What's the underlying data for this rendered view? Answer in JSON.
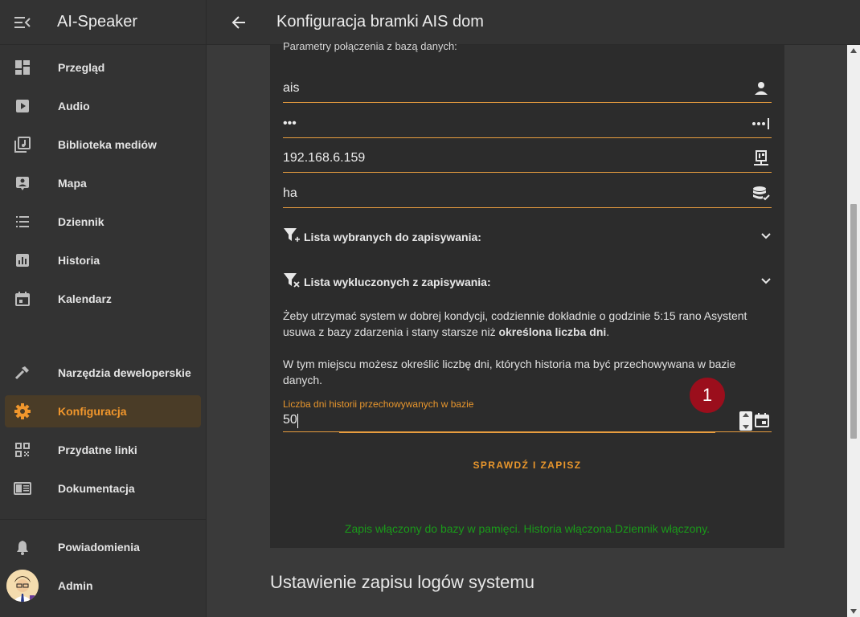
{
  "sidebar": {
    "app_title": "AI-Speaker",
    "items": [
      {
        "label": "Przegląd",
        "icon": "dashboard-icon"
      },
      {
        "label": "Audio",
        "icon": "play-box-icon"
      },
      {
        "label": "Biblioteka mediów",
        "icon": "music-library-icon"
      },
      {
        "label": "Mapa",
        "icon": "account-box-icon"
      },
      {
        "label": "Dziennik",
        "icon": "list-icon"
      },
      {
        "label": "Historia",
        "icon": "chart-box-icon"
      },
      {
        "label": "Kalendarz",
        "icon": "calendar-icon"
      },
      {
        "label": "Narzędzia deweloperskie",
        "icon": "hammer-icon"
      },
      {
        "label": "Konfiguracja",
        "icon": "gear-icon",
        "active": true
      },
      {
        "label": "Przydatne linki",
        "icon": "qr-code-icon"
      },
      {
        "label": "Dokumentacja",
        "icon": "book-icon"
      },
      {
        "label": "Powiadomienia",
        "icon": "bell-icon"
      },
      {
        "label": "Admin",
        "icon": "avatar"
      }
    ]
  },
  "topbar": {
    "title": "Konfiguracja bramki AIS dom"
  },
  "card": {
    "params_label": "Parametry połączenia z bazą danych:",
    "fields": [
      {
        "value": "ais",
        "icon": "account-icon"
      },
      {
        "value": "•••",
        "icon": "password-dots-icon"
      },
      {
        "value": "192.168.6.159",
        "icon": "ip-network-icon"
      },
      {
        "value": "ha",
        "icon": "database-check-icon"
      }
    ],
    "include_list": "Lista wybranych do zapisywania:",
    "exclude_list": "Lista wykluczonych z zapisywania:",
    "para1_a": "Żeby utrzymać system w dobrej kondycji, codziennie dokładnie o godzinie 5:15 rano Asystent usuwa z bazy zdarzenia i stany starsze niż ",
    "para1_b": "określona liczba dni",
    "para1_c": ".",
    "para2": "W tym miejscu możesz określić liczbę dni, których historia ma być przechowywana w bazie danych.",
    "days_label": "Liczba dni historii przechowywanych w bazie",
    "days_value": "50",
    "badge": "1",
    "action": "SPRAWDŹ I ZAPISZ",
    "status": "Zapis włączony do bazy w pamięci. Historia włączona.Dziennik włączony."
  },
  "section_title": "Ustawienie zapisu logów systemu",
  "colors": {
    "accent": "#e8962c",
    "active_bg": "#4a3c27",
    "badge": "#9b0e1c",
    "status_green": "#1a9a1a"
  }
}
